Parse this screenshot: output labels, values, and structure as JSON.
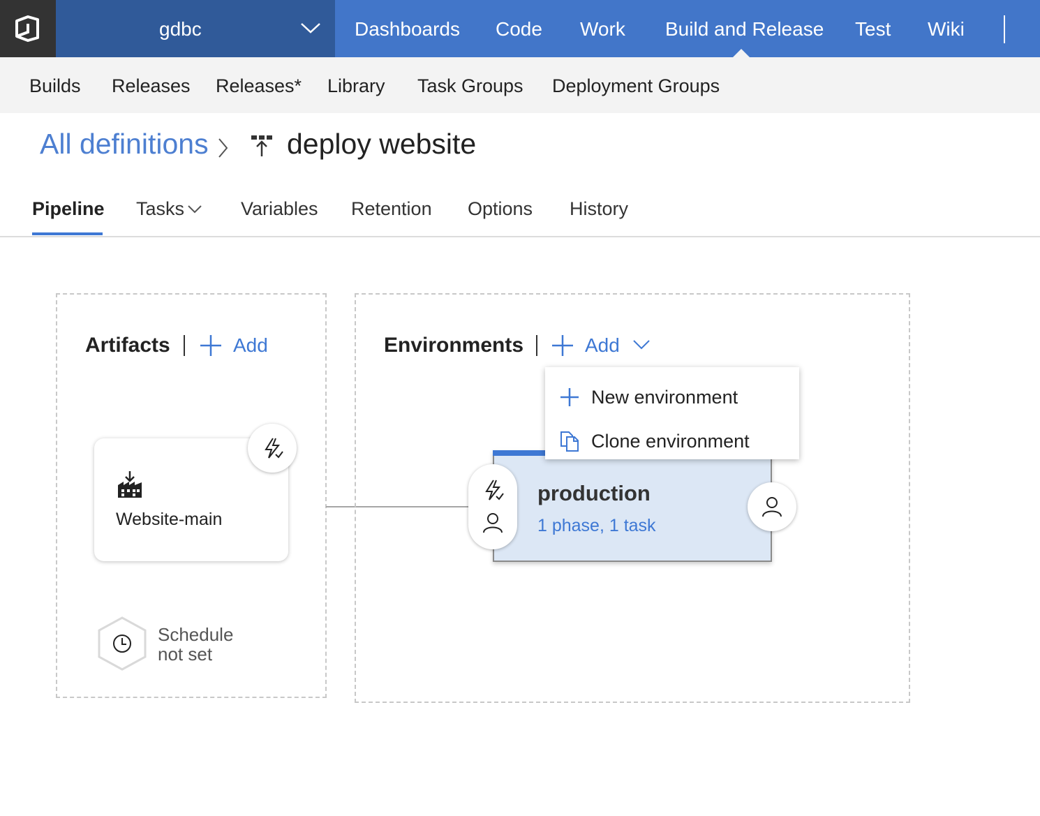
{
  "topbar": {
    "project": "gdbc",
    "hubs": [
      "Dashboards",
      "Code",
      "Work",
      "Build and Release",
      "Test",
      "Wiki"
    ],
    "active_hub": "Build and Release"
  },
  "subnav": {
    "items": [
      "Builds",
      "Releases",
      "Releases*",
      "Library",
      "Task Groups",
      "Deployment Groups"
    ]
  },
  "breadcrumb": {
    "parent": "All definitions",
    "title": "deploy website"
  },
  "tabs": {
    "items": [
      "Pipeline",
      "Tasks",
      "Variables",
      "Retention",
      "Options",
      "History"
    ],
    "active": "Pipeline"
  },
  "artifacts": {
    "title": "Artifacts",
    "add_label": "Add",
    "card_name": "Website-main",
    "schedule_line1": "Schedule",
    "schedule_line2": "not set"
  },
  "environments": {
    "title": "Environments",
    "add_label": "Add",
    "menu": {
      "new": "New environment",
      "clone": "Clone environment"
    },
    "card": {
      "name": "production",
      "summary": "1 phase, 1 task"
    }
  },
  "colors": {
    "topbar": "#4276c9",
    "project_bar": "#305a99",
    "accent": "#3e78d4",
    "env_card_bg": "#dce7f5"
  }
}
